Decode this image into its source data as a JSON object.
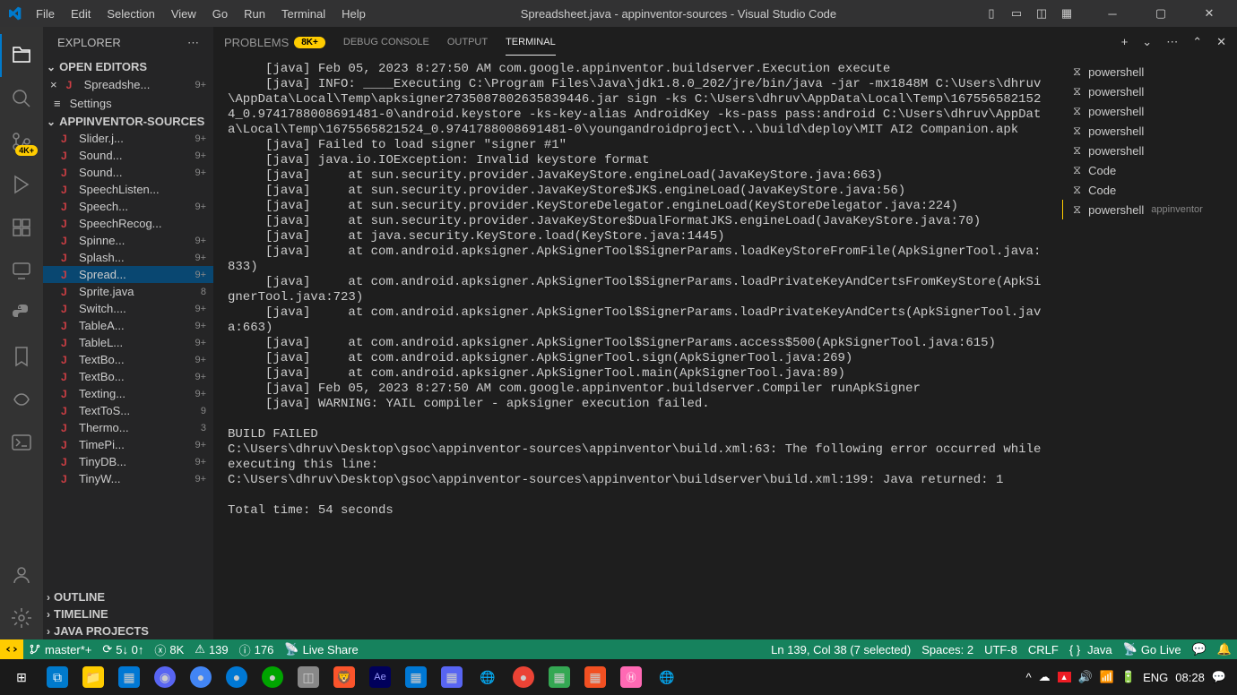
{
  "titlebar": {
    "title": "Spreadsheet.java - appinventor-sources - Visual Studio Code"
  },
  "menu": [
    "File",
    "Edit",
    "Selection",
    "View",
    "Go",
    "Run",
    "Terminal",
    "Help"
  ],
  "sidebar": {
    "title": "EXPLORER",
    "open_editors": "OPEN EDITORS",
    "editor_tab": {
      "name": "Spreadshe...",
      "badge": "9+"
    },
    "settings": "Settings",
    "folder": "APPINVENTOR-SOURCES",
    "files": [
      {
        "name": "Slider.j...",
        "badge": "9+"
      },
      {
        "name": "Sound...",
        "badge": "9+"
      },
      {
        "name": "Sound...",
        "badge": "9+"
      },
      {
        "name": "SpeechListen...",
        "badge": ""
      },
      {
        "name": "Speech...",
        "badge": "9+"
      },
      {
        "name": "SpeechRecog...",
        "badge": ""
      },
      {
        "name": "Spinne...",
        "badge": "9+"
      },
      {
        "name": "Splash...",
        "badge": "9+"
      },
      {
        "name": "Spread...",
        "badge": "9+"
      },
      {
        "name": "Sprite.java",
        "badge": "8"
      },
      {
        "name": "Switch....",
        "badge": "9+"
      },
      {
        "name": "TableA...",
        "badge": "9+"
      },
      {
        "name": "TableL...",
        "badge": "9+"
      },
      {
        "name": "TextBo...",
        "badge": "9+"
      },
      {
        "name": "TextBo...",
        "badge": "9+"
      },
      {
        "name": "Texting...",
        "badge": "9+"
      },
      {
        "name": "TextToS...",
        "badge": "9"
      },
      {
        "name": "Thermo...",
        "badge": "3"
      },
      {
        "name": "TimePi...",
        "badge": "9+"
      },
      {
        "name": "TinyDB...",
        "badge": "9+"
      },
      {
        "name": "TinyW...",
        "badge": "9+"
      }
    ],
    "outline": "OUTLINE",
    "timeline": "TIMELINE",
    "java_projects": "JAVA PROJECTS"
  },
  "panel": {
    "tabs": {
      "problems": "PROBLEMS",
      "problems_badge": "8K+",
      "debug": "DEBUG CONSOLE",
      "output": "OUTPUT",
      "terminal": "TERMINAL"
    }
  },
  "terminal": {
    "output": "     [java] Feb 05, 2023 8:27:50 AM com.google.appinventor.buildserver.Execution execute\n     [java] INFO: ____Executing C:\\Program Files\\Java\\jdk1.8.0_202/jre/bin/java -jar -mx1848M C:\\Users\\dhruv\\AppData\\Local\\Temp\\apksigner2735087802635839446.jar sign -ks C:\\Users\\dhruv\\AppData\\Local\\Temp\\1675565821524_0.9741788008691481-0\\android.keystore -ks-key-alias AndroidKey -ks-pass pass:android C:\\Users\\dhruv\\AppData\\Local\\Temp\\1675565821524_0.9741788008691481-0\\youngandroidproject\\..\\build\\deploy\\MIT AI2 Companion.apk\n     [java] Failed to load signer \"signer #1\"\n     [java] java.io.IOException: Invalid keystore format\n     [java]     at sun.security.provider.JavaKeyStore.engineLoad(JavaKeyStore.java:663)\n     [java]     at sun.security.provider.JavaKeyStore$JKS.engineLoad(JavaKeyStore.java:56)\n     [java]     at sun.security.provider.KeyStoreDelegator.engineLoad(KeyStoreDelegator.java:224)\n     [java]     at sun.security.provider.JavaKeyStore$DualFormatJKS.engineLoad(JavaKeyStore.java:70)\n     [java]     at java.security.KeyStore.load(KeyStore.java:1445)\n     [java]     at com.android.apksigner.ApkSignerTool$SignerParams.loadKeyStoreFromFile(ApkSignerTool.java:833)\n     [java]     at com.android.apksigner.ApkSignerTool$SignerParams.loadPrivateKeyAndCertsFromKeyStore(ApkSignerTool.java:723)\n     [java]     at com.android.apksigner.ApkSignerTool$SignerParams.loadPrivateKeyAndCerts(ApkSignerTool.java:663)\n     [java]     at com.android.apksigner.ApkSignerTool$SignerParams.access$500(ApkSignerTool.java:615)\n     [java]     at com.android.apksigner.ApkSignerTool.sign(ApkSignerTool.java:269)\n     [java]     at com.android.apksigner.ApkSignerTool.main(ApkSignerTool.java:89)\n     [java] Feb 05, 2023 8:27:50 AM com.google.appinventor.buildserver.Compiler runApkSigner\n     [java] WARNING: YAIL compiler - apksigner execution failed.\n\nBUILD FAILED\nC:\\Users\\dhruv\\Desktop\\gsoc\\appinventor-sources\\appinventor\\build.xml:63: The following error occurred while executing this line:\nC:\\Users\\dhruv\\Desktop\\gsoc\\appinventor-sources\\appinventor\\buildserver\\build.xml:199: Java returned: 1\n\nTotal time: 54 seconds",
    "sessions": [
      {
        "name": "powershell",
        "extra": ""
      },
      {
        "name": "powershell",
        "extra": ""
      },
      {
        "name": "powershell",
        "extra": ""
      },
      {
        "name": "powershell",
        "extra": ""
      },
      {
        "name": "powershell",
        "extra": ""
      },
      {
        "name": "Code",
        "extra": ""
      },
      {
        "name": "Code",
        "extra": ""
      },
      {
        "name": "powershell",
        "extra": "appinventor"
      }
    ]
  },
  "activity_badge": "4K+",
  "status": {
    "branch": "master*+",
    "sync": "5↓ 0↑",
    "errors": "8K",
    "warnings": "139",
    "info": "176",
    "live_share": "Live Share",
    "position": "Ln 139, Col 38 (7 selected)",
    "spaces": "Spaces: 2",
    "encoding": "UTF-8",
    "eol": "CRLF",
    "lang": "Java",
    "go_live": "Go Live",
    "remote_sync": "⟳"
  },
  "taskbar": {
    "lang": "ENG",
    "time": "08:28"
  }
}
